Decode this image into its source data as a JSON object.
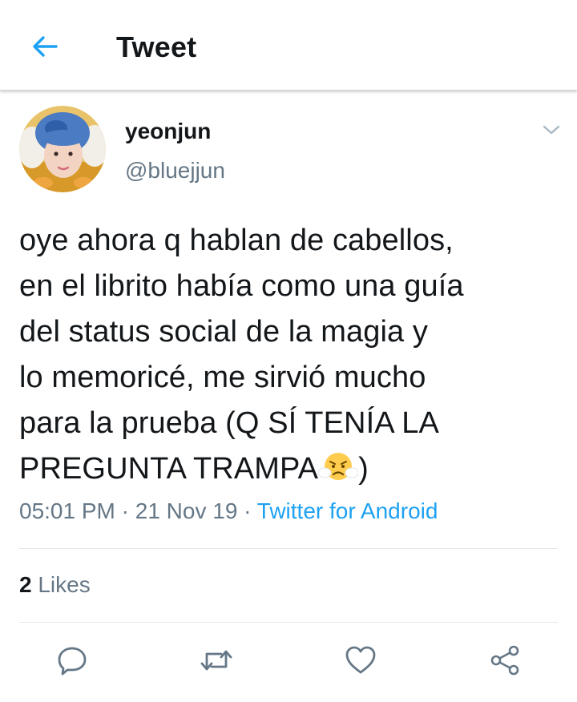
{
  "header": {
    "title": "Tweet",
    "back_icon": "arrow-left-icon",
    "accent_color": "#1da1f2"
  },
  "author": {
    "name": "yeonjun",
    "handle": "@bluejjun"
  },
  "tweet": {
    "lines": [
      "oye ahora q hablan de cabellos,",
      "en el librito había como una guía",
      "del status social de la magia y",
      "lo memoricé, me sirvió mucho",
      "para la prueba (Q SÍ TENÍA LA",
      "PREGUNTA TRAMPA",
      ")"
    ],
    "emoji": "face-with-steam-from-nose-icon"
  },
  "meta": {
    "time": "05:01 PM",
    "sep1": " · ",
    "date": "21 Nov 19",
    "sep2": " · ",
    "source": "Twitter for Android"
  },
  "stats": {
    "likes_count": "2",
    "likes_label": " Likes"
  },
  "actions": {
    "reply_icon": "reply-icon",
    "retweet_icon": "retweet-icon",
    "like_icon": "heart-icon",
    "share_icon": "share-icon"
  },
  "colors": {
    "text": "#14171a",
    "secondary": "#657786",
    "accent": "#1da1f2",
    "divider": "#e1e8ed"
  }
}
